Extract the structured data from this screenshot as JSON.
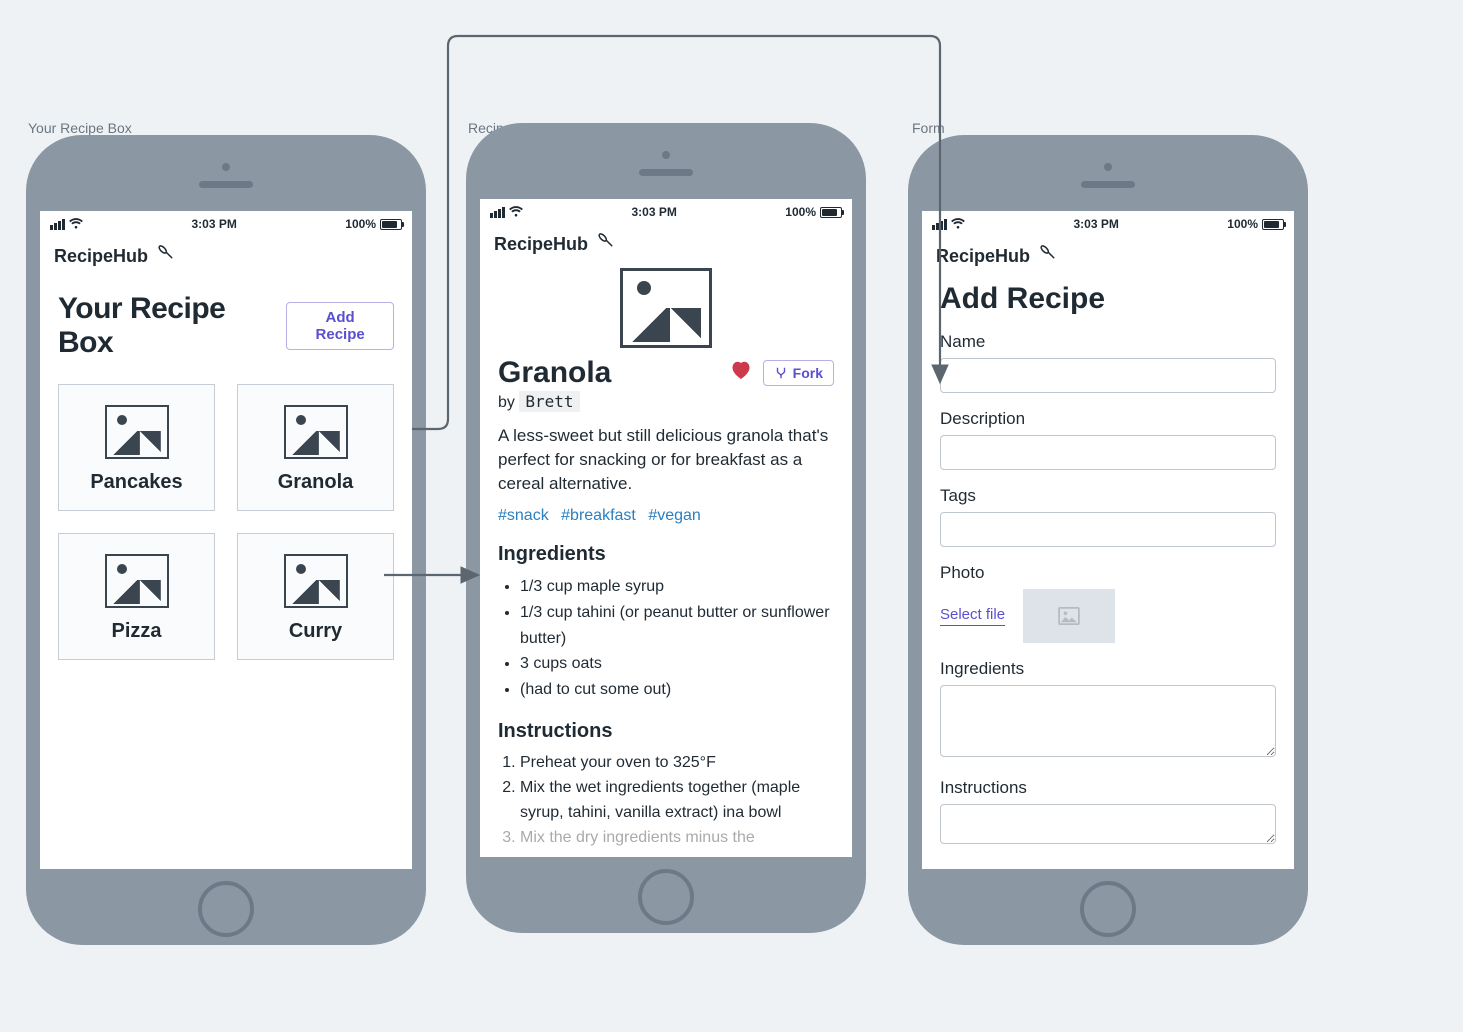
{
  "frame_labels": {
    "box": "Your Recipe Box",
    "view": "Recipe View",
    "form": "Form"
  },
  "status": {
    "time": "3:03 PM",
    "battery": "100%"
  },
  "app_name": "RecipeHub",
  "screen1": {
    "title": "Your Recipe Box",
    "add_button": "Add Recipe",
    "cards": [
      "Pancakes",
      "Granola",
      "Pizza",
      "Curry"
    ]
  },
  "screen2": {
    "title": "Granola",
    "fork_label": "Fork",
    "by_prefix": "by",
    "author": "Brett",
    "description": "A less-sweet but still delicious granola that's perfect for snacking or for breakfast as a cereal alternative.",
    "tags": [
      "#snack",
      "#breakfast",
      "#vegan"
    ],
    "ingredients_heading": "Ingredients",
    "ingredients": [
      "1/3 cup maple syrup",
      "1/3 cup tahini (or peanut butter or sunflower butter)",
      "3 cups oats",
      "(had to cut some out)"
    ],
    "instructions_heading": "Instructions",
    "instructions": [
      "Preheat your oven to 325°F",
      "Mix the wet ingredients together (maple syrup, tahini, vanilla extract) ina bowl",
      "Mix the dry ingredients minus the"
    ]
  },
  "screen3": {
    "title": "Add Recipe",
    "labels": {
      "name": "Name",
      "description": "Description",
      "tags": "Tags",
      "photo": "Photo",
      "select_file": "Select file",
      "ingredients": "Ingredients",
      "instructions": "Instructions"
    }
  }
}
